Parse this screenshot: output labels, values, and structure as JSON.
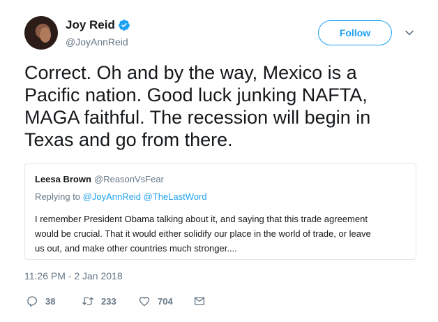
{
  "author": {
    "name": "Joy Reid",
    "handle": "@JoyAnnReid",
    "verified": true
  },
  "follow_button": {
    "label": "Follow"
  },
  "tweet": {
    "text_lines": [
      "Correct. Oh and by the way, Mexico is a",
      "Pacific nation. Good luck junking NAFTA,",
      "MAGA faithful. The recession will begin in",
      "Texas and go from there."
    ],
    "timestamp": "11:26 PM - 2 Jan 2018"
  },
  "quoted": {
    "name": "Leesa Brown",
    "handle": "@ReasonVsFear",
    "replying_prefix": "Replying to",
    "replying_mentions": "@JoyAnnReid @TheLastWord",
    "body_lines": [
      "I remember President Obama talking about it, and saying that this trade agreement",
      "would be crucial. That it would either solidify our place in the world of trade, or leave",
      "us out, and make other countries much stronger...."
    ]
  },
  "actions": {
    "reply_count": "38",
    "retweet_count": "233",
    "like_count": "704"
  },
  "colors": {
    "accent": "#1da1f2",
    "muted": "#657786",
    "border": "#e1e8ed",
    "text": "#14171a"
  },
  "icons": {
    "verified": "verified-badge-icon",
    "caret": "chevron-down-icon",
    "reply": "reply-icon",
    "retweet": "retweet-icon",
    "like": "heart-icon",
    "dm": "envelope-icon"
  }
}
